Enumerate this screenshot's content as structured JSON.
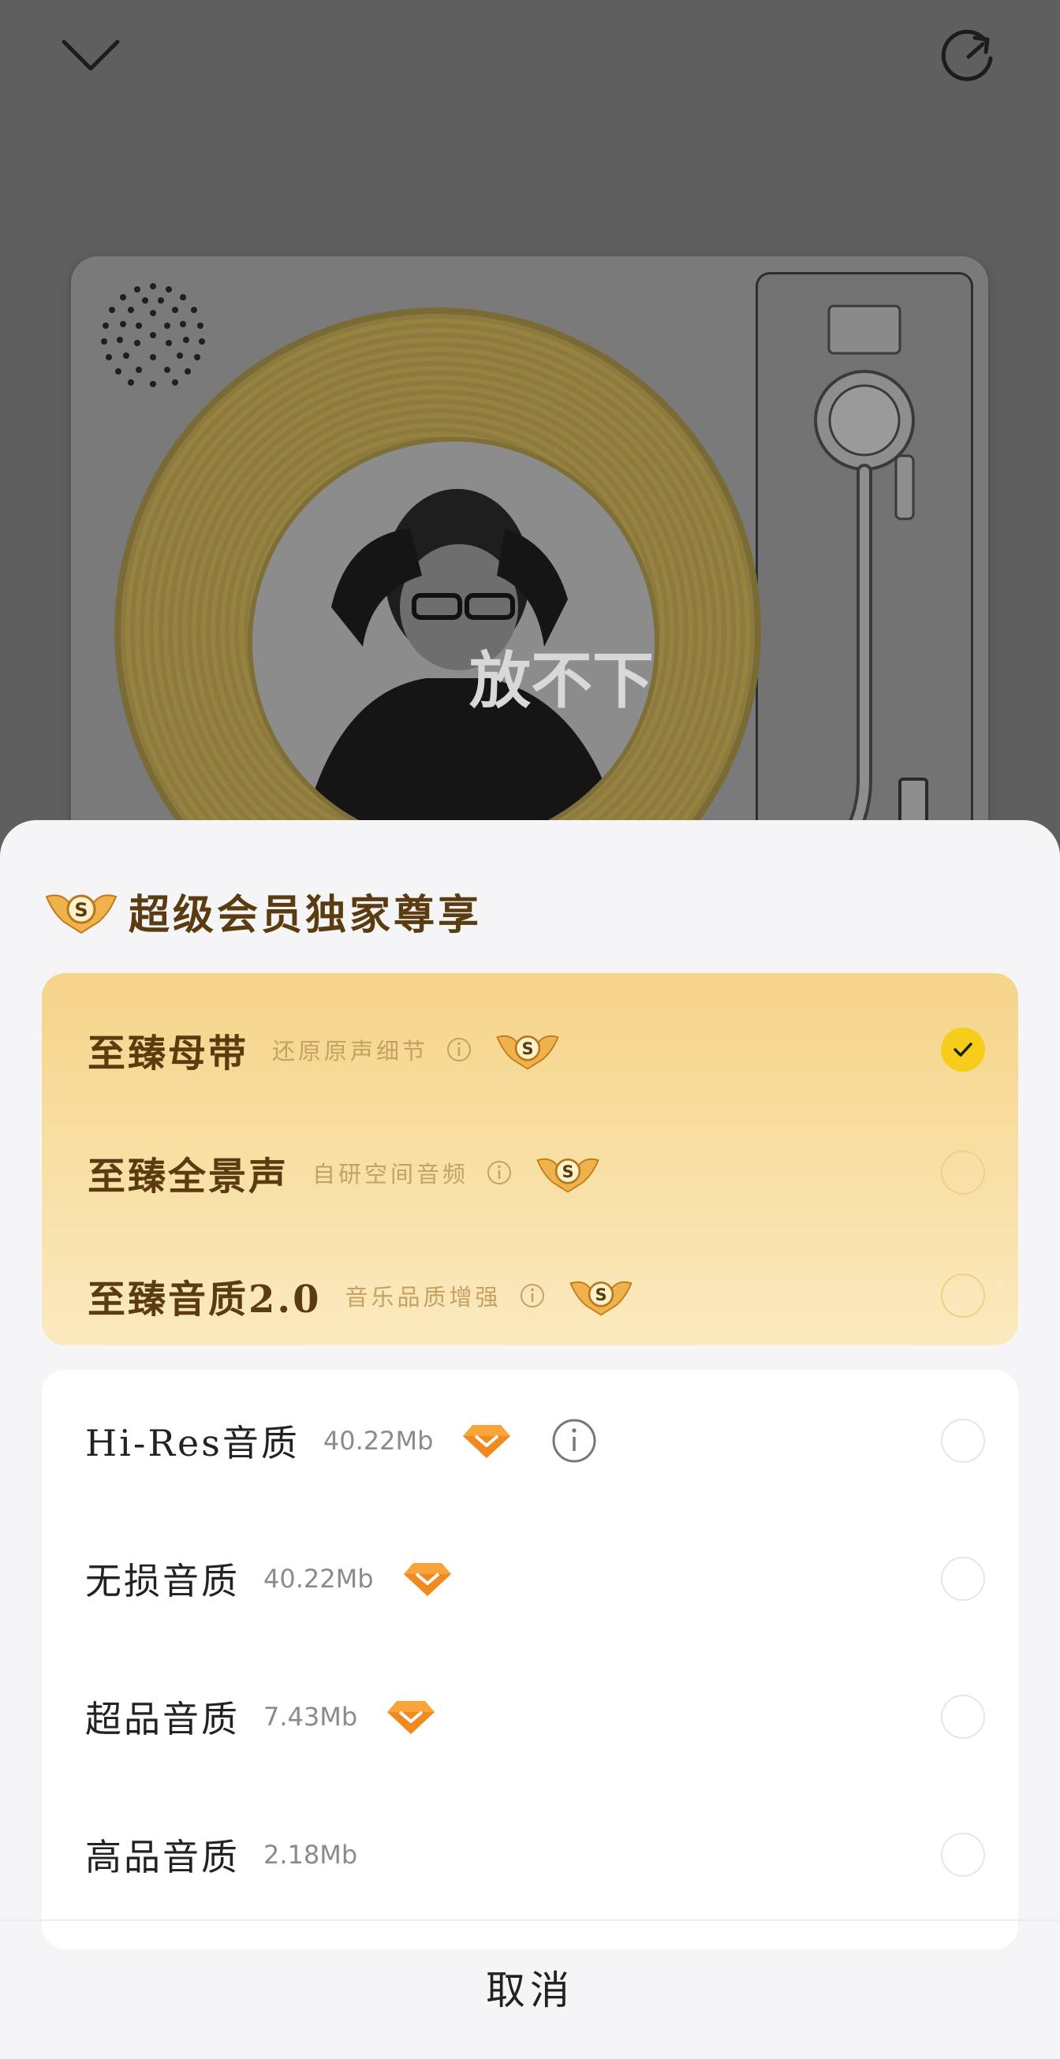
{
  "player": {
    "collapse_icon": "chevron-down-icon",
    "refresh_icon": "refresh-icon",
    "cover_text": "放不下"
  },
  "sheet": {
    "title": "超级会员独家尊享",
    "svip_badge_text": "S",
    "premium_options": [
      {
        "name": "至臻母带",
        "desc": "还原原声细节",
        "selected": true
      },
      {
        "name": "至臻全景声",
        "desc": "自研空间音频",
        "selected": false
      },
      {
        "name": "至臻音质2.0",
        "desc": "音乐品质增强",
        "selected": false
      }
    ],
    "quality_options": [
      {
        "name": "Hi-Res音质",
        "size": "40.22Mb",
        "vip": true,
        "info": true,
        "selected": false
      },
      {
        "name": "无损音质",
        "size": "40.22Mb",
        "vip": true,
        "info": false,
        "selected": false
      },
      {
        "name": "超品音质",
        "size": "7.43Mb",
        "vip": true,
        "info": false,
        "selected": false
      },
      {
        "name": "高品音质",
        "size": "2.18Mb",
        "vip": false,
        "info": false,
        "selected": false
      }
    ],
    "cancel_label": "取消"
  },
  "colors": {
    "accent_check": "#f7cd1b",
    "premium_text": "#5a3c10",
    "premium_desc": "#c4a262"
  }
}
